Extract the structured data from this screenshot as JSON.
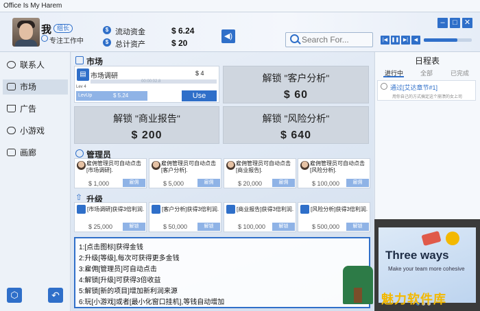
{
  "window": {
    "title": "Office Is My Harem",
    "min_icon": "minimize-icon",
    "max_icon": "maximize-icon",
    "close_icon": "close-icon"
  },
  "user": {
    "name": "我",
    "badge": "组长",
    "status": "专注工作中"
  },
  "stats": {
    "cash_label": "流动资金",
    "cash_value": "$ 6.24",
    "assets_label": "总计资产",
    "assets_value": "$ 20"
  },
  "search": {
    "placeholder": "Search For..."
  },
  "player": {
    "volume_level": 0.7
  },
  "nav": [
    {
      "label": "联系人",
      "icon": "chat-icon"
    },
    {
      "label": "市场",
      "icon": "briefcase-icon"
    },
    {
      "label": "广告",
      "icon": "cart-icon"
    },
    {
      "label": "小游戏",
      "icon": "gamepad-icon"
    },
    {
      "label": "画廊",
      "icon": "gallery-icon"
    }
  ],
  "market": {
    "title": "市场",
    "item": {
      "name": "市场调研",
      "price": "$ 4",
      "timer": "00:00:02.8",
      "level": "Lev 4",
      "levelup_label": "LevUp",
      "levelup_cost": "$ 5.24",
      "use_label": "Use",
      "progress": 0.0
    },
    "locked": [
      {
        "title": "解锁 \"客户分析\"",
        "price": "$ 60"
      },
      {
        "title": "解锁 \"商业报告\"",
        "price": "$ 200"
      },
      {
        "title": "解锁 \"风险分析\"",
        "price": "$ 640"
      }
    ]
  },
  "managers": {
    "title": "管理员",
    "items": [
      {
        "text": "雇佣管理员可自动点击[市场调研].",
        "price": "$ 1,000",
        "btn": "雇佣"
      },
      {
        "text": "雇佣管理员可自动点击[客户分析].",
        "price": "$ 5,000",
        "btn": "雇佣"
      },
      {
        "text": "雇佣管理员可自动点击[商业报告].",
        "price": "$ 20,000",
        "btn": "雇佣"
      },
      {
        "text": "雇佣管理员可自动点击[风险分析].",
        "price": "$ 100,000",
        "btn": "雇佣"
      }
    ]
  },
  "upgrades": {
    "title": "升级",
    "items": [
      {
        "text": "[市场调研]获得3倍利润.",
        "price": "$ 25,000",
        "btn": "解锁"
      },
      {
        "text": "[客户分析]获得3倍利润.",
        "price": "$ 50,000",
        "btn": "解锁"
      },
      {
        "text": "[商业报告]获得3倍利润.",
        "price": "$ 100,000",
        "btn": "解锁"
      },
      {
        "text": "[风险分析]获得3倍利润.",
        "price": "$ 500,000",
        "btn": "解锁"
      }
    ]
  },
  "tips": [
    "1:[点击图标]获得金钱",
    "2:升级[等级],每次可获得更多金钱",
    "3:雇佣[管理员]可自动点击",
    "4:解锁[升级]可获得3倍收益",
    "5:解锁[新的项目]增加新利润来源",
    "6:玩[小游戏]或者[最小化窗口挂机],等钱自动增加"
  ],
  "schedule": {
    "title": "日程表",
    "tabs": [
      "进行中",
      "全部",
      "已完成"
    ],
    "item_title": "通过[艾达章节#1]",
    "item_desc": "用你自己的方式搞定这个崩溃的女上司"
  },
  "ad": {
    "title": "Three ways",
    "subtitle": "Make your team more cohesive",
    "watermark": "魅力软件库"
  }
}
